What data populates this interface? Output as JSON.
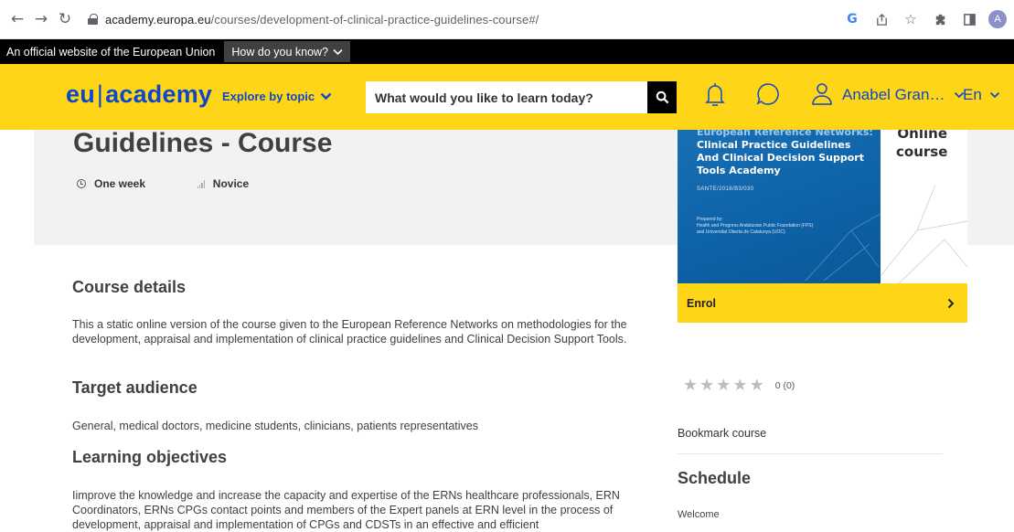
{
  "browser": {
    "url_host": "academy.europa.eu",
    "url_path": "/courses/development-of-clinical-practice-guidelines-course#/",
    "avatar_letter": "A",
    "google_letter": "G"
  },
  "eu_bar": {
    "official_text": "An official website of the European Union",
    "how_know": "How do you know?"
  },
  "header": {
    "logo_left": "eu",
    "logo_sep": "|",
    "logo_right": "academy",
    "explore_label": "Explore by topic",
    "search_placeholder": "What would you like to learn today?",
    "user_name": "Anabel Gran…",
    "language": "En",
    "colors": {
      "yellow": "#ffd617",
      "blue": "#0e47cb"
    }
  },
  "course": {
    "title": "Guidelines - Course",
    "duration": "One week",
    "level": "Novice"
  },
  "card": {
    "cover_line1": "European Reference Networks:",
    "cover_line2": "Clinical Practice Guidelines",
    "cover_line3": "And Clinical Decision Support",
    "cover_line4": "Tools Academy",
    "cover_code": "SANTE/2018/B3/030",
    "cover_prep1": "Prepared by:",
    "cover_prep2": "Health and Progress Andalusian Public Foundation (FPS)",
    "cover_prep3": "and Universitat Oberta de Catalunya (UOC)",
    "online_line1": "Online",
    "online_line2": "course",
    "enrol_label": "Enrol"
  },
  "sections": {
    "course_details_title": "Course details",
    "course_details_text": "This a static online version of the course given to the European Reference Networks on methodologies for the development, appraisal and implementation of clinical practice guidelines and Clinical Decision Support Tools.",
    "target_title": "Target audience",
    "target_text": "General, medical doctors, medicine students, clinicians, patients representatives",
    "learning_title": "Learning objectives",
    "learning_text": "Iimprove the knowledge and increase the capacity and expertise of the ERNs healthcare professionals, ERN Coordinators, ERNs CPGs contact points and members of the Expert panels at ERN level in the process of development, appraisal and implementation of CPGs and CDSTs in an effective and efficient"
  },
  "sidebar": {
    "rating_text": "0 (0)",
    "stars_filled": 0,
    "stars_total": 5,
    "bookmark_label": "Bookmark course",
    "schedule_title": "Schedule",
    "schedule_first": "Welcome"
  }
}
